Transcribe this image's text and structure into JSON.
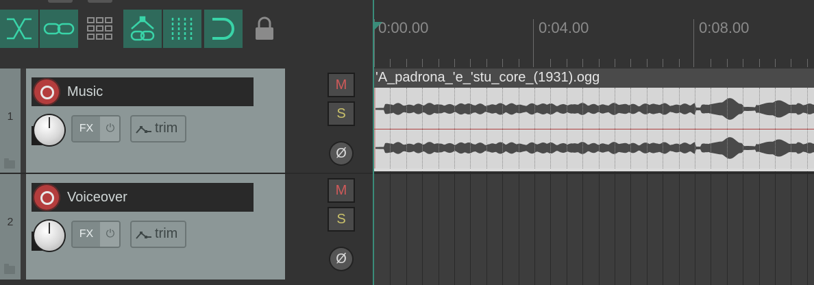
{
  "toolbar": {
    "buttons": [
      {
        "name": "crossfade-icon",
        "active": true
      },
      {
        "name": "link-icon",
        "active": true
      },
      {
        "name": "grid-view-icon",
        "active": false
      },
      {
        "name": "envelope-link-icon",
        "active": true
      },
      {
        "name": "snap-grid-icon",
        "active": true
      },
      {
        "name": "magnet-snap-icon",
        "active": true
      },
      {
        "name": "lock-icon",
        "active": false
      }
    ]
  },
  "ruler": {
    "labels": [
      "0:00.00",
      "0:04.00",
      "0:08.00"
    ]
  },
  "tracks": [
    {
      "number": "1",
      "name": "Music",
      "fx_label": "FX",
      "fx_power": "⏻",
      "trim_label": "trim",
      "mute_label": "M",
      "solo_label": "S",
      "phase_label": "Ø"
    },
    {
      "number": "2",
      "name": "Voiceover",
      "fx_label": "FX",
      "fx_power": "⏻",
      "trim_label": "trim",
      "mute_label": "M",
      "solo_label": "S",
      "phase_label": "Ø"
    }
  ],
  "media_item": {
    "filename": "'A_padrona_'e_'stu_core_(1931).ogg"
  },
  "colors": {
    "accent": "#2f6a5b",
    "record": "#b43d3d",
    "mute": "#d05a5a",
    "solo": "#c9c06a",
    "playhead": "#3a8c7a"
  }
}
